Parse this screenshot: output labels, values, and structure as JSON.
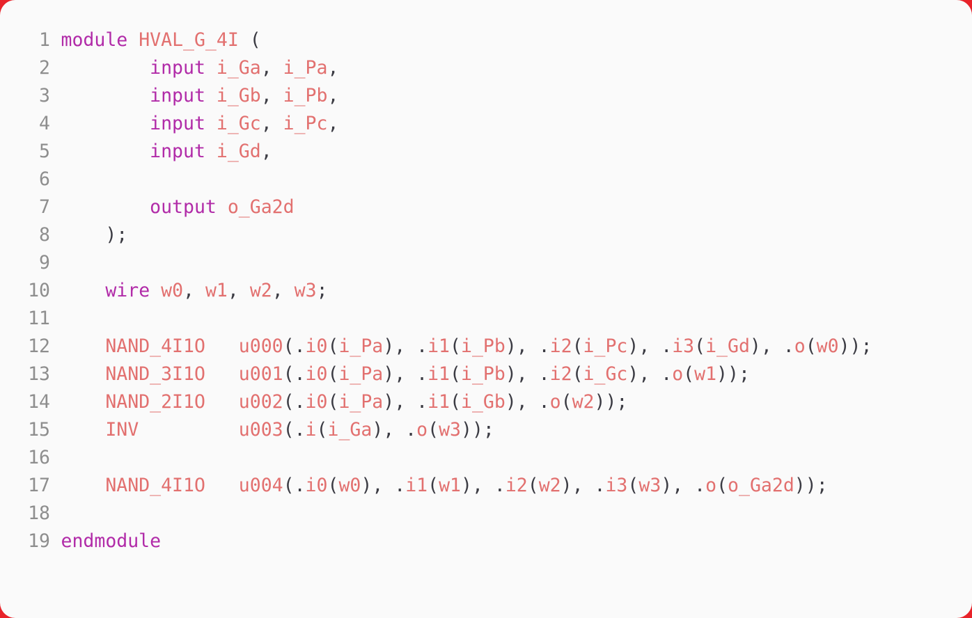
{
  "editor": {
    "language": "verilog",
    "background_color": "#fafafa",
    "border_color": "#e8232a",
    "line_number_color": "#8e8e8e",
    "keyword_color": "#b12ba8",
    "identifier_color": "#e2706f",
    "punctuation_color": "#3b3b43",
    "total_lines": 19
  },
  "lines": [
    {
      "number": "1",
      "text": "module HVAL_G_4I (",
      "tokens": [
        {
          "t": "module",
          "c": "kw"
        },
        {
          "t": " ",
          "c": "plain"
        },
        {
          "t": "HVAL_G_4I",
          "c": "id"
        },
        {
          "t": " ",
          "c": "plain"
        },
        {
          "t": "(",
          "c": "punct"
        }
      ]
    },
    {
      "number": "2",
      "text": "        input i_Ga, i_Pa,",
      "tokens": [
        {
          "t": "        ",
          "c": "plain"
        },
        {
          "t": "input",
          "c": "kw"
        },
        {
          "t": " ",
          "c": "plain"
        },
        {
          "t": "i_Ga",
          "c": "id"
        },
        {
          "t": ", ",
          "c": "punct"
        },
        {
          "t": "i_Pa",
          "c": "id"
        },
        {
          "t": ",",
          "c": "punct"
        }
      ]
    },
    {
      "number": "3",
      "text": "        input i_Gb, i_Pb,",
      "tokens": [
        {
          "t": "        ",
          "c": "plain"
        },
        {
          "t": "input",
          "c": "kw"
        },
        {
          "t": " ",
          "c": "plain"
        },
        {
          "t": "i_Gb",
          "c": "id"
        },
        {
          "t": ", ",
          "c": "punct"
        },
        {
          "t": "i_Pb",
          "c": "id"
        },
        {
          "t": ",",
          "c": "punct"
        }
      ]
    },
    {
      "number": "4",
      "text": "        input i_Gc, i_Pc,",
      "tokens": [
        {
          "t": "        ",
          "c": "plain"
        },
        {
          "t": "input",
          "c": "kw"
        },
        {
          "t": " ",
          "c": "plain"
        },
        {
          "t": "i_Gc",
          "c": "id"
        },
        {
          "t": ", ",
          "c": "punct"
        },
        {
          "t": "i_Pc",
          "c": "id"
        },
        {
          "t": ",",
          "c": "punct"
        }
      ]
    },
    {
      "number": "5",
      "text": "        input i_Gd,",
      "tokens": [
        {
          "t": "        ",
          "c": "plain"
        },
        {
          "t": "input",
          "c": "kw"
        },
        {
          "t": " ",
          "c": "plain"
        },
        {
          "t": "i_Gd",
          "c": "id"
        },
        {
          "t": ",",
          "c": "punct"
        }
      ]
    },
    {
      "number": "6",
      "text": "",
      "tokens": []
    },
    {
      "number": "7",
      "text": "        output o_Ga2d",
      "tokens": [
        {
          "t": "        ",
          "c": "plain"
        },
        {
          "t": "output",
          "c": "kw"
        },
        {
          "t": " ",
          "c": "plain"
        },
        {
          "t": "o_Ga2d",
          "c": "id"
        }
      ]
    },
    {
      "number": "8",
      "text": "    );",
      "tokens": [
        {
          "t": "    ",
          "c": "plain"
        },
        {
          "t": ");",
          "c": "punct"
        }
      ]
    },
    {
      "number": "9",
      "text": "",
      "tokens": []
    },
    {
      "number": "10",
      "text": "    wire w0, w1, w2, w3;",
      "tokens": [
        {
          "t": "    ",
          "c": "plain"
        },
        {
          "t": "wire",
          "c": "kw"
        },
        {
          "t": " ",
          "c": "plain"
        },
        {
          "t": "w0",
          "c": "id"
        },
        {
          "t": ", ",
          "c": "punct"
        },
        {
          "t": "w1",
          "c": "id"
        },
        {
          "t": ", ",
          "c": "punct"
        },
        {
          "t": "w2",
          "c": "id"
        },
        {
          "t": ", ",
          "c": "punct"
        },
        {
          "t": "w3",
          "c": "id"
        },
        {
          "t": ";",
          "c": "punct"
        }
      ]
    },
    {
      "number": "11",
      "text": "",
      "tokens": []
    },
    {
      "number": "12",
      "text": "    NAND_4I1O   u000(.i0(i_Pa), .i1(i_Pb), .i2(i_Pc), .i3(i_Gd), .o(w0));",
      "tokens": [
        {
          "t": "    ",
          "c": "plain"
        },
        {
          "t": "NAND_4I1O",
          "c": "id"
        },
        {
          "t": "   ",
          "c": "plain"
        },
        {
          "t": "u000",
          "c": "id"
        },
        {
          "t": "(.",
          "c": "punct"
        },
        {
          "t": "i0",
          "c": "id"
        },
        {
          "t": "(",
          "c": "punct"
        },
        {
          "t": "i_Pa",
          "c": "id"
        },
        {
          "t": "), .",
          "c": "punct"
        },
        {
          "t": "i1",
          "c": "id"
        },
        {
          "t": "(",
          "c": "punct"
        },
        {
          "t": "i_Pb",
          "c": "id"
        },
        {
          "t": "), .",
          "c": "punct"
        },
        {
          "t": "i2",
          "c": "id"
        },
        {
          "t": "(",
          "c": "punct"
        },
        {
          "t": "i_Pc",
          "c": "id"
        },
        {
          "t": "), .",
          "c": "punct"
        },
        {
          "t": "i3",
          "c": "id"
        },
        {
          "t": "(",
          "c": "punct"
        },
        {
          "t": "i_Gd",
          "c": "id"
        },
        {
          "t": "), .",
          "c": "punct"
        },
        {
          "t": "o",
          "c": "id"
        },
        {
          "t": "(",
          "c": "punct"
        },
        {
          "t": "w0",
          "c": "id"
        },
        {
          "t": "));",
          "c": "punct"
        }
      ]
    },
    {
      "number": "13",
      "text": "    NAND_3I1O   u001(.i0(i_Pa), .i1(i_Pb), .i2(i_Gc), .o(w1));",
      "tokens": [
        {
          "t": "    ",
          "c": "plain"
        },
        {
          "t": "NAND_3I1O",
          "c": "id"
        },
        {
          "t": "   ",
          "c": "plain"
        },
        {
          "t": "u001",
          "c": "id"
        },
        {
          "t": "(.",
          "c": "punct"
        },
        {
          "t": "i0",
          "c": "id"
        },
        {
          "t": "(",
          "c": "punct"
        },
        {
          "t": "i_Pa",
          "c": "id"
        },
        {
          "t": "), .",
          "c": "punct"
        },
        {
          "t": "i1",
          "c": "id"
        },
        {
          "t": "(",
          "c": "punct"
        },
        {
          "t": "i_Pb",
          "c": "id"
        },
        {
          "t": "), .",
          "c": "punct"
        },
        {
          "t": "i2",
          "c": "id"
        },
        {
          "t": "(",
          "c": "punct"
        },
        {
          "t": "i_Gc",
          "c": "id"
        },
        {
          "t": "), .",
          "c": "punct"
        },
        {
          "t": "o",
          "c": "id"
        },
        {
          "t": "(",
          "c": "punct"
        },
        {
          "t": "w1",
          "c": "id"
        },
        {
          "t": "));",
          "c": "punct"
        }
      ]
    },
    {
      "number": "14",
      "text": "    NAND_2I1O   u002(.i0(i_Pa), .i1(i_Gb), .o(w2));",
      "tokens": [
        {
          "t": "    ",
          "c": "plain"
        },
        {
          "t": "NAND_2I1O",
          "c": "id"
        },
        {
          "t": "   ",
          "c": "plain"
        },
        {
          "t": "u002",
          "c": "id"
        },
        {
          "t": "(.",
          "c": "punct"
        },
        {
          "t": "i0",
          "c": "id"
        },
        {
          "t": "(",
          "c": "punct"
        },
        {
          "t": "i_Pa",
          "c": "id"
        },
        {
          "t": "), .",
          "c": "punct"
        },
        {
          "t": "i1",
          "c": "id"
        },
        {
          "t": "(",
          "c": "punct"
        },
        {
          "t": "i_Gb",
          "c": "id"
        },
        {
          "t": "), .",
          "c": "punct"
        },
        {
          "t": "o",
          "c": "id"
        },
        {
          "t": "(",
          "c": "punct"
        },
        {
          "t": "w2",
          "c": "id"
        },
        {
          "t": "));",
          "c": "punct"
        }
      ]
    },
    {
      "number": "15",
      "text": "    INV         u003(.i(i_Ga), .o(w3));",
      "tokens": [
        {
          "t": "    ",
          "c": "plain"
        },
        {
          "t": "INV",
          "c": "id"
        },
        {
          "t": "         ",
          "c": "plain"
        },
        {
          "t": "u003",
          "c": "id"
        },
        {
          "t": "(.",
          "c": "punct"
        },
        {
          "t": "i",
          "c": "id"
        },
        {
          "t": "(",
          "c": "punct"
        },
        {
          "t": "i_Ga",
          "c": "id"
        },
        {
          "t": "), .",
          "c": "punct"
        },
        {
          "t": "o",
          "c": "id"
        },
        {
          "t": "(",
          "c": "punct"
        },
        {
          "t": "w3",
          "c": "id"
        },
        {
          "t": "));",
          "c": "punct"
        }
      ]
    },
    {
      "number": "16",
      "text": "",
      "tokens": []
    },
    {
      "number": "17",
      "text": "    NAND_4I1O   u004(.i0(w0), .i1(w1), .i2(w2), .i3(w3), .o(o_Ga2d));",
      "tokens": [
        {
          "t": "    ",
          "c": "plain"
        },
        {
          "t": "NAND_4I1O",
          "c": "id"
        },
        {
          "t": "   ",
          "c": "plain"
        },
        {
          "t": "u004",
          "c": "id"
        },
        {
          "t": "(.",
          "c": "punct"
        },
        {
          "t": "i0",
          "c": "id"
        },
        {
          "t": "(",
          "c": "punct"
        },
        {
          "t": "w0",
          "c": "id"
        },
        {
          "t": "), .",
          "c": "punct"
        },
        {
          "t": "i1",
          "c": "id"
        },
        {
          "t": "(",
          "c": "punct"
        },
        {
          "t": "w1",
          "c": "id"
        },
        {
          "t": "), .",
          "c": "punct"
        },
        {
          "t": "i2",
          "c": "id"
        },
        {
          "t": "(",
          "c": "punct"
        },
        {
          "t": "w2",
          "c": "id"
        },
        {
          "t": "), .",
          "c": "punct"
        },
        {
          "t": "i3",
          "c": "id"
        },
        {
          "t": "(",
          "c": "punct"
        },
        {
          "t": "w3",
          "c": "id"
        },
        {
          "t": "), .",
          "c": "punct"
        },
        {
          "t": "o",
          "c": "id"
        },
        {
          "t": "(",
          "c": "punct"
        },
        {
          "t": "o_Ga2d",
          "c": "id"
        },
        {
          "t": "));",
          "c": "punct"
        }
      ]
    },
    {
      "number": "18",
      "text": "",
      "tokens": []
    },
    {
      "number": "19",
      "text": "endmodule",
      "tokens": [
        {
          "t": "endmodule",
          "c": "kw"
        }
      ]
    }
  ]
}
